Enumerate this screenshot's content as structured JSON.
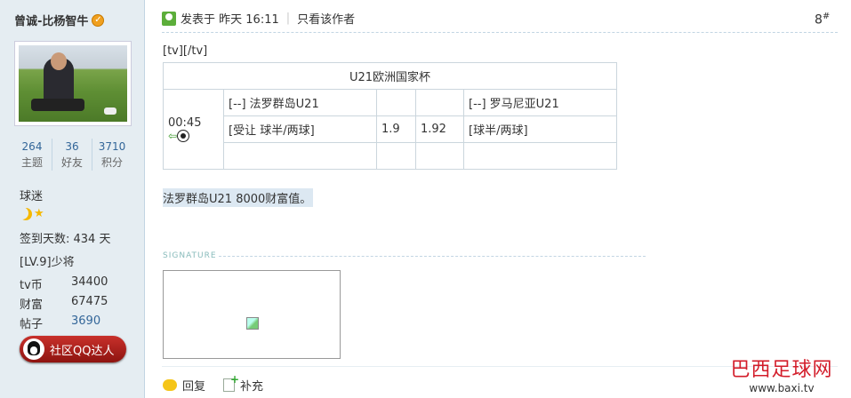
{
  "author": {
    "username": "曾诚-比杨智牛",
    "stats": [
      {
        "value": "264",
        "label": "主题"
      },
      {
        "value": "36",
        "label": "好友"
      },
      {
        "value": "3710",
        "label": "积分"
      }
    ],
    "group": "球迷",
    "sign_days": "签到天数: 434 天",
    "level": "[LV.9]少将",
    "tv_coins_label": "tv币",
    "tv_coins": "34400",
    "wealth_label": "财富",
    "wealth": "67475",
    "posts_label": "帖子",
    "posts": "3690",
    "qq_badge": "社区QQ达人"
  },
  "post": {
    "posted_label": "发表于",
    "posted_time": "昨天 16:11",
    "only_author": "只看该作者",
    "floor": "8",
    "floor_mark": "#",
    "tv_tags": "[tv][/tv]",
    "match": {
      "title": "U21欧洲国家杯",
      "time": "00:45",
      "home_team": "[--] 法罗群岛U21",
      "away_team": "[--] 罗马尼亚U21",
      "handicap": "[受让 球半/两球]",
      "odds_home": "1.9",
      "odds_away": "1.92",
      "handicap_away": "[球半/两球]"
    },
    "message": "法罗群岛U21  8000财富值。",
    "signature_label": "SIGNATURE",
    "reply": "回复",
    "supplement": "补充"
  },
  "watermark": {
    "title": "巴西足球网",
    "url": "www.baxi.tv"
  }
}
